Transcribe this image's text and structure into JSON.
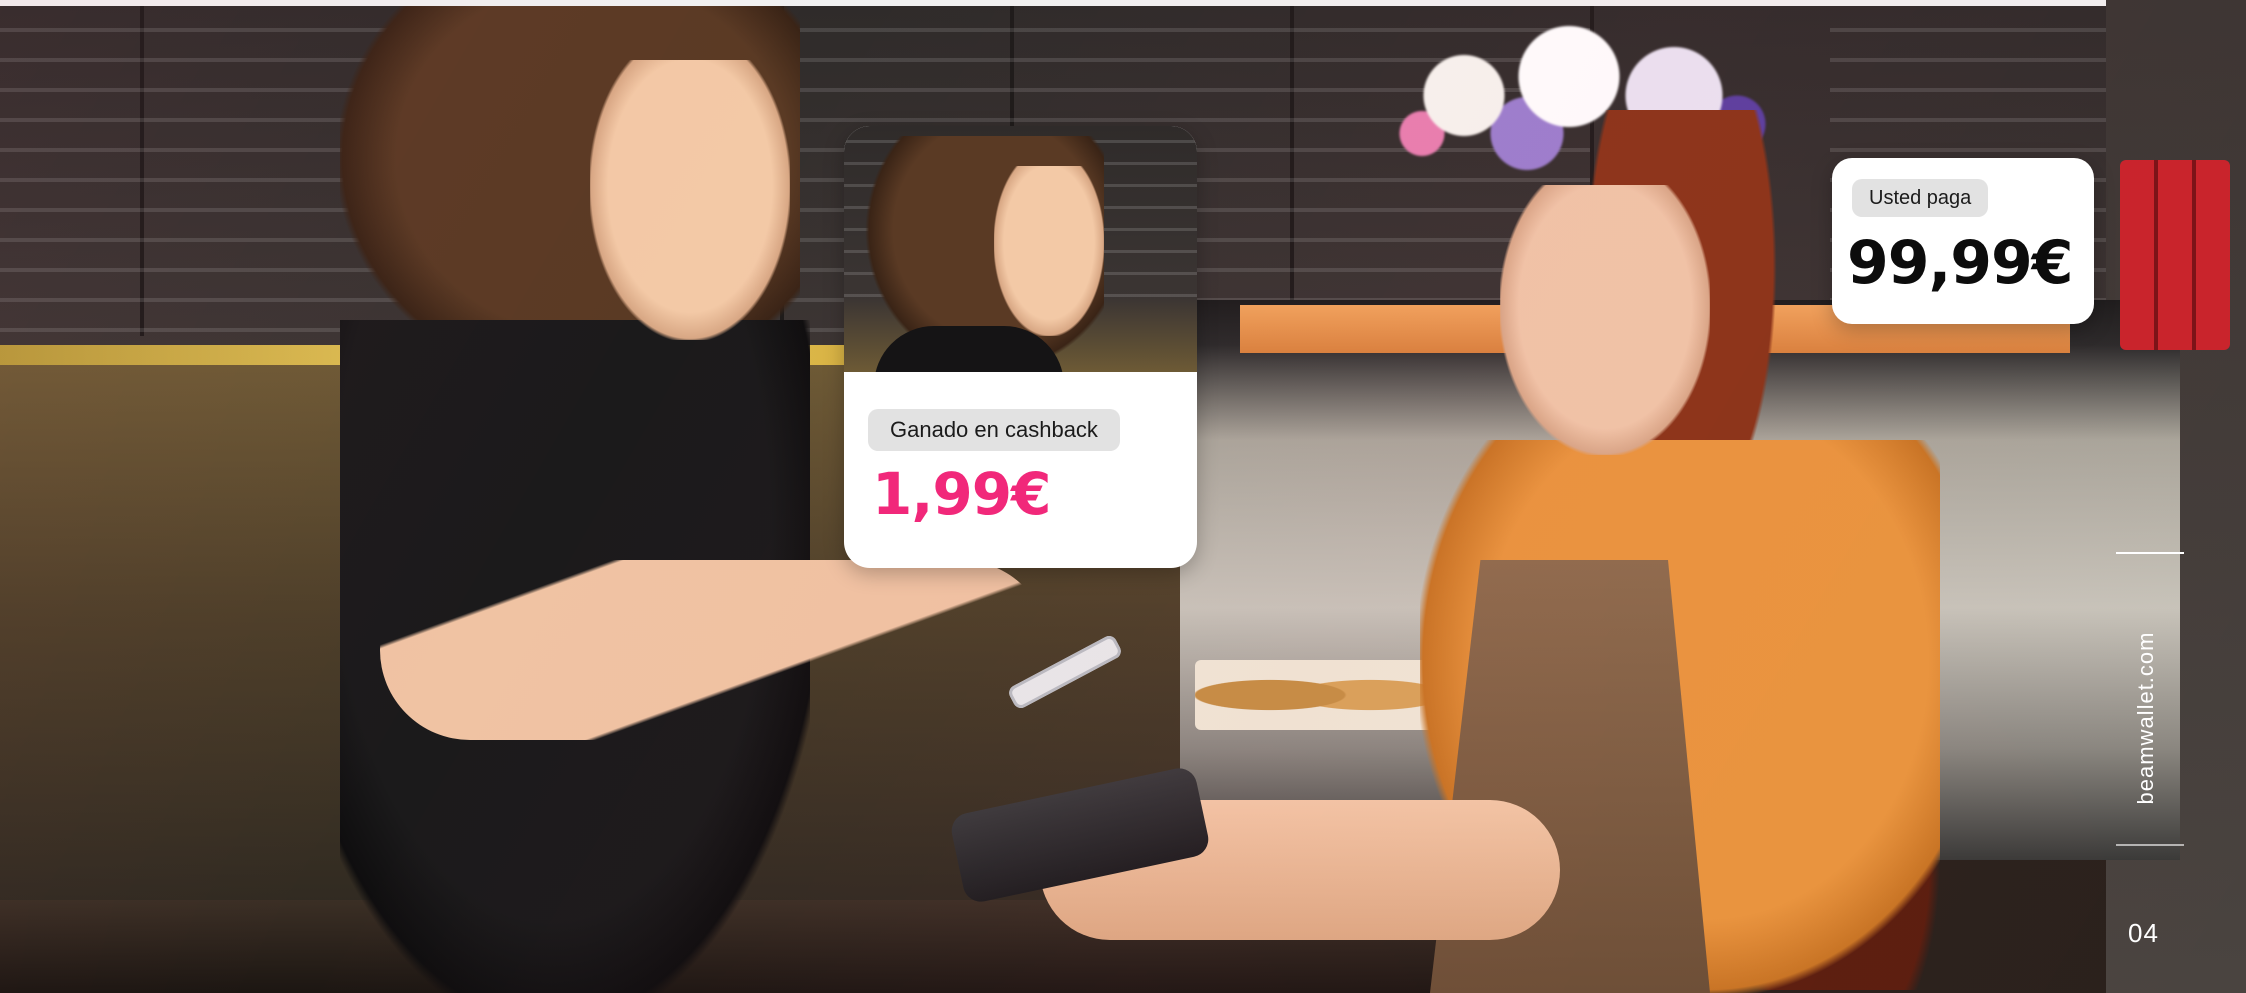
{
  "cashback_card": {
    "label": "Ganado en cashback",
    "amount": "1,99€",
    "amount_color": "#f1287a"
  },
  "payment_card": {
    "label": "Usted paga",
    "amount": "99,99€",
    "amount_color": "#0c0c0c"
  },
  "side": {
    "url": "beamwallet.com"
  },
  "footer": {
    "page_number": "04"
  }
}
